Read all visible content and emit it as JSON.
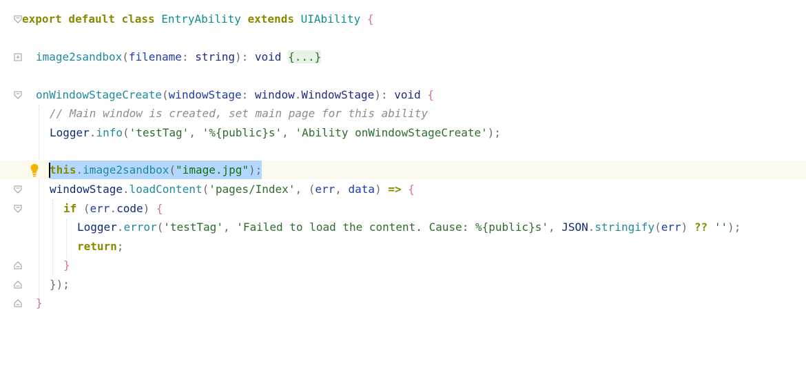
{
  "editor": {
    "lines": [
      {
        "tokens": [
          {
            "t": "export default class ",
            "c": "kw"
          },
          {
            "t": "EntryAbility",
            "c": "cls"
          },
          {
            "t": " extends ",
            "c": "kw"
          },
          {
            "t": "UIAbility",
            "c": "cls"
          },
          {
            "t": " {",
            "c": "brc"
          }
        ]
      },
      {
        "tokens": [
          {
            "t": "image2sandbox",
            "c": "fnc"
          },
          {
            "t": "(",
            "c": "pun"
          },
          {
            "t": "filename",
            "c": "par"
          },
          {
            "t": ": ",
            "c": "pun"
          },
          {
            "t": "string",
            "c": "typ"
          },
          {
            "t": "): ",
            "c": "pun"
          },
          {
            "t": "void",
            "c": "typ"
          },
          {
            "t": " ",
            "c": "pun"
          },
          {
            "t": "{...}",
            "c": "fold"
          }
        ]
      },
      {
        "tokens": [
          {
            "t": "onWindowStageCreate",
            "c": "fnc"
          },
          {
            "t": "(",
            "c": "pun"
          },
          {
            "t": "windowStage",
            "c": "par"
          },
          {
            "t": ": ",
            "c": "pun"
          },
          {
            "t": "window",
            "c": "typ"
          },
          {
            "t": ".",
            "c": "pun"
          },
          {
            "t": "WindowStage",
            "c": "typ"
          },
          {
            "t": "): ",
            "c": "pun"
          },
          {
            "t": "void",
            "c": "typ"
          },
          {
            "t": " {",
            "c": "brc"
          }
        ]
      },
      {
        "tokens": [
          {
            "t": "// Main window is created, set main page for this ability",
            "c": "cm"
          }
        ]
      },
      {
        "tokens": [
          {
            "t": "Logger",
            "c": "id"
          },
          {
            "t": ".",
            "c": "pun"
          },
          {
            "t": "info",
            "c": "fnc"
          },
          {
            "t": "(",
            "c": "pun"
          },
          {
            "t": "'testTag'",
            "c": "str"
          },
          {
            "t": ", ",
            "c": "pun"
          },
          {
            "t": "'%{public}s'",
            "c": "str"
          },
          {
            "t": ", ",
            "c": "pun"
          },
          {
            "t": "'Ability onWindowStageCreate'",
            "c": "str"
          },
          {
            "t": ");",
            "c": "pun"
          }
        ]
      },
      {
        "tokens": [
          {
            "t": "this",
            "c": "kw"
          },
          {
            "t": ".",
            "c": "pun"
          },
          {
            "t": "image2sandbox",
            "c": "fnc"
          },
          {
            "t": "(",
            "c": "pun"
          },
          {
            "t": "\"image.jpg\"",
            "c": "strd"
          },
          {
            "t": ");",
            "c": "pun"
          }
        ]
      },
      {
        "tokens": [
          {
            "t": "windowStage",
            "c": "id"
          },
          {
            "t": ".",
            "c": "pun"
          },
          {
            "t": "loadContent",
            "c": "fnc"
          },
          {
            "t": "(",
            "c": "pun"
          },
          {
            "t": "'pages/Index'",
            "c": "str"
          },
          {
            "t": ", (",
            "c": "pun"
          },
          {
            "t": "err",
            "c": "par"
          },
          {
            "t": ", ",
            "c": "pun"
          },
          {
            "t": "data",
            "c": "par"
          },
          {
            "t": ") ",
            "c": "pun"
          },
          {
            "t": "=>",
            "c": "kw"
          },
          {
            "t": " {",
            "c": "brc"
          }
        ]
      },
      {
        "tokens": [
          {
            "t": "if",
            "c": "kw"
          },
          {
            "t": " (",
            "c": "pun"
          },
          {
            "t": "err",
            "c": "par"
          },
          {
            "t": ".",
            "c": "pun"
          },
          {
            "t": "code",
            "c": "id"
          },
          {
            "t": ") ",
            "c": "pun"
          },
          {
            "t": "{",
            "c": "brc"
          }
        ]
      },
      {
        "tokens": [
          {
            "t": "Logger",
            "c": "id"
          },
          {
            "t": ".",
            "c": "pun"
          },
          {
            "t": "error",
            "c": "fnc"
          },
          {
            "t": "(",
            "c": "pun"
          },
          {
            "t": "'testTag'",
            "c": "str"
          },
          {
            "t": ", ",
            "c": "pun"
          },
          {
            "t": "'Failed to load the content. Cause: %{public}s'",
            "c": "str"
          },
          {
            "t": ", ",
            "c": "pun"
          },
          {
            "t": "JSON",
            "c": "id"
          },
          {
            "t": ".",
            "c": "pun"
          },
          {
            "t": "stringify",
            "c": "fnc"
          },
          {
            "t": "(",
            "c": "pun"
          },
          {
            "t": "err",
            "c": "par"
          },
          {
            "t": ") ",
            "c": "pun"
          },
          {
            "t": "??",
            "c": "kw"
          },
          {
            "t": " ",
            "c": "pun"
          },
          {
            "t": "''",
            "c": "str"
          },
          {
            "t": ");",
            "c": "pun"
          }
        ]
      },
      {
        "tokens": [
          {
            "t": "return",
            "c": "kw"
          },
          {
            "t": ";",
            "c": "pun"
          }
        ]
      },
      {
        "tokens": [
          {
            "t": "}",
            "c": "brc"
          }
        ]
      },
      {
        "tokens": [
          {
            "t": "});",
            "c": "pun"
          }
        ]
      },
      {
        "tokens": [
          {
            "t": "}",
            "c": "brc"
          }
        ]
      }
    ],
    "gutter_icons": {
      "fold_open": "fold-open-icon",
      "fold_collapsed": "fold-collapsed-icon",
      "fold_end": "fold-end-icon",
      "intention": "lightbulb-icon"
    },
    "colors": {
      "keyword": "#888a00",
      "class_name": "#0b8f8f",
      "function": "#1f8a9c",
      "string": "#2f6b2f",
      "comment": "#8c8c8c",
      "brace": "#d66fa8",
      "selection": "#b3d7ff",
      "current_line": "#fcfaed"
    }
  }
}
